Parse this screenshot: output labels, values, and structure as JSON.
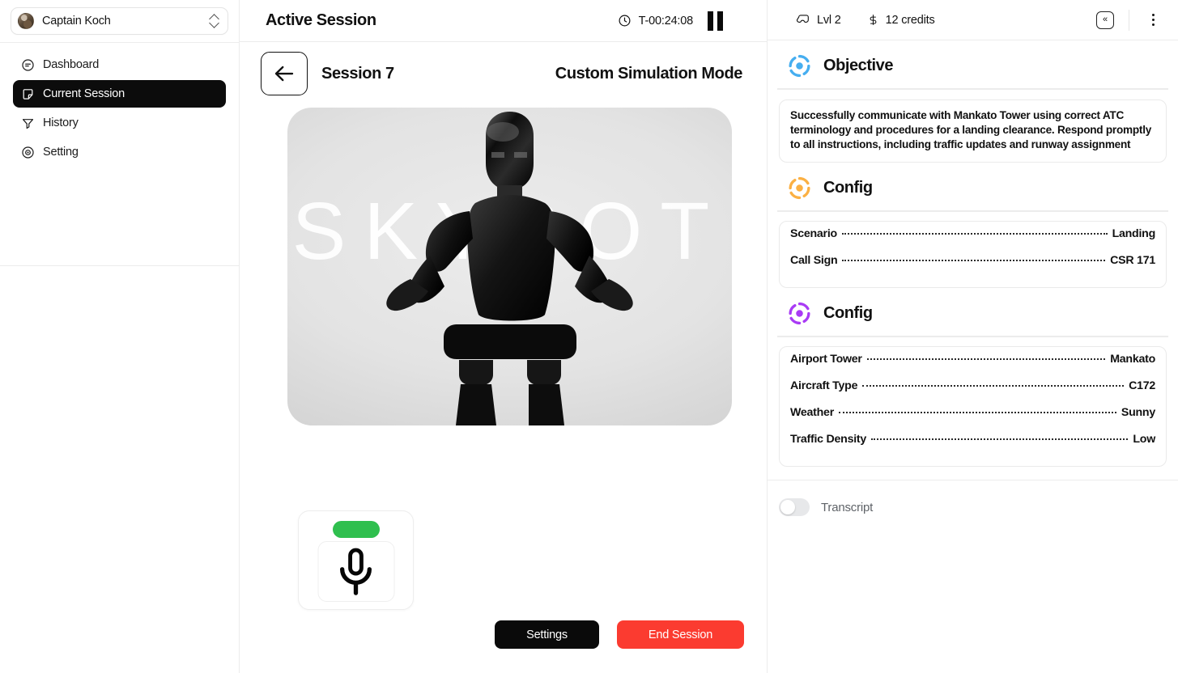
{
  "sidebar": {
    "user": {
      "name": "Captain Koch",
      "avatar_icon": "user-avatar-photo",
      "chevron_icon": "up-down-chevron-icon"
    },
    "items": [
      {
        "label": "Dashboard",
        "icon": "circle-minus-icon",
        "active": false
      },
      {
        "label": "Current Session",
        "icon": "sticky-note-icon",
        "active": true
      },
      {
        "label": "History",
        "icon": "funnel-filter-icon",
        "active": false
      },
      {
        "label": "Setting",
        "icon": "target-circle-icon",
        "active": false
      }
    ]
  },
  "main": {
    "title": "Active Session",
    "timer": "T-00:24:08",
    "clock_icon": "clock-icon",
    "pause_icon": "pause-icon",
    "back_icon": "arrow-left-icon",
    "session_name": "Session 7",
    "mode_label": "Custom Simulation Mode",
    "robot_watermark": "SKYBOT",
    "mic": {
      "status_icon": "green-status-pill",
      "icon": "microphone-icon"
    },
    "buttons": {
      "settings": "Settings",
      "end_session": "End Session"
    }
  },
  "right_panel": {
    "level": {
      "label": "Lvl 2",
      "icon": "inbox-icon"
    },
    "credits": {
      "label": "12 credits",
      "icon": "dollar-icon"
    },
    "collapse_icon": "collapse-left-icon",
    "kebab_icon": "more-vertical-icon",
    "objective": {
      "title": "Objective",
      "icon": "target-ring-icon",
      "accent": "#46AEF0",
      "text": "Successfully communicate with Mankato Tower using correct ATC terminology and procedures for a landing clearance. Respond promptly to all instructions, including traffic updates and runway assignment"
    },
    "config_primary": {
      "title": "Config",
      "icon": "target-ring-icon",
      "accent": "#FBB043",
      "rows": [
        {
          "label": "Scenario",
          "value": "Landing"
        },
        {
          "label": "Call Sign",
          "value": "CSR 171"
        }
      ]
    },
    "config_secondary": {
      "title": "Config",
      "icon": "target-ring-icon",
      "accent": "#A93BF5",
      "rows": [
        {
          "label": "Airport Tower",
          "value": "Mankato"
        },
        {
          "label": "Aircraft Type",
          "value": "C172"
        },
        {
          "label": "Weather",
          "value": "Sunny"
        },
        {
          "label": "Traffic Density",
          "value": "Low"
        }
      ]
    },
    "transcript": {
      "label": "Transcript",
      "enabled": false
    }
  },
  "colors": {
    "danger": "#FB3B30",
    "dark": "#0A0A0A",
    "mic_status": "#2FBF4E",
    "objective_accent": "#46AEF0",
    "config_primary_accent": "#FBB043",
    "config_secondary_accent": "#A93BF5"
  }
}
